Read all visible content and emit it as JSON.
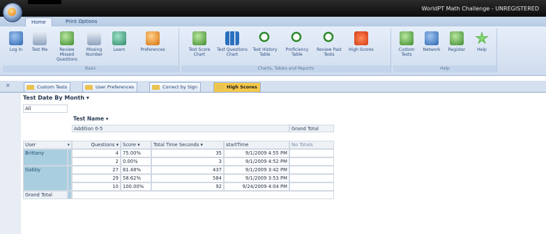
{
  "window": {
    "title": "WorldPT Math Challenge - UNREGISTERED"
  },
  "ribbon": {
    "tabs": [
      {
        "label": "Home"
      },
      {
        "label": "Print Options"
      }
    ],
    "groups": [
      {
        "label": "Basic",
        "buttons": [
          {
            "label": "Log In",
            "icon": "login-icon"
          },
          {
            "label": "Test Me",
            "icon": "test-icon"
          },
          {
            "label": "Review Missed Questions",
            "icon": "review-icon"
          },
          {
            "label": "Missing Number",
            "icon": "missing-number-icon"
          },
          {
            "label": "Learn",
            "icon": "learn-icon"
          },
          {
            "label": "Preferences",
            "icon": "preferences-icon"
          }
        ]
      },
      {
        "label": "Charts, Tables and Reports",
        "buttons": [
          {
            "label": "Test Score Chart",
            "icon": "line-chart-icon"
          },
          {
            "label": "Test Questions Chart",
            "icon": "bar-chart-icon"
          },
          {
            "label": "Test History Table",
            "icon": "magnifier-icon"
          },
          {
            "label": "Proficiency Table",
            "icon": "magnifier-icon"
          },
          {
            "label": "Review Past Tests",
            "icon": "magnifier-icon"
          },
          {
            "label": "High Scores",
            "icon": "heart-icon"
          }
        ]
      },
      {
        "label": "Help",
        "buttons": [
          {
            "label": "Custom Tests",
            "icon": "tools-icon"
          },
          {
            "label": "Network",
            "icon": "network-icon"
          },
          {
            "label": "Register",
            "icon": "register-icon"
          },
          {
            "label": "Help",
            "icon": "star-icon"
          }
        ]
      }
    ]
  },
  "doc_tabs": [
    {
      "label": "Custom Tests",
      "active": false
    },
    {
      "label": "User Preferences",
      "active": false
    },
    {
      "label": "Correct by Sign",
      "active": false
    },
    {
      "label": "High Scores",
      "active": true
    }
  ],
  "pivot": {
    "filter_field": "Test Date By Month ▾",
    "filter_value": "All",
    "column_field": "Test Name ▾",
    "column_group": "Addition 0-5",
    "grand_total_label": "Grand Total",
    "no_totals": "No Totals",
    "row_field": "User",
    "value_headers": [
      "Questions ▾",
      "Score ▾",
      "Total Time Seconds ▾",
      "startTime"
    ],
    "rows": [
      {
        "user": "Brittany",
        "questions": "4",
        "score": "75.00%",
        "time": "35",
        "start": "9/1/2009 4:55 PM"
      },
      {
        "user": "",
        "questions": "2",
        "score": "0.00%",
        "time": "3",
        "start": "9/1/2009 4:52 PM"
      },
      {
        "user": "Gabby",
        "questions": "27",
        "score": "81.48%",
        "time": "437",
        "start": "9/1/2009 3:42 PM"
      },
      {
        "user": "",
        "questions": "29",
        "score": "58.62%",
        "time": "584",
        "start": "9/1/2009 3:53 PM"
      },
      {
        "user": "",
        "questions": "10",
        "score": "100.00%",
        "time": "92",
        "start": "9/24/2009 4:04 PM"
      }
    ],
    "grand_total_row": "Grand Total"
  },
  "colors": {
    "accent": "#2e66b2",
    "active_tab": "#f5c84a",
    "user_cell": "#a9cee0"
  }
}
